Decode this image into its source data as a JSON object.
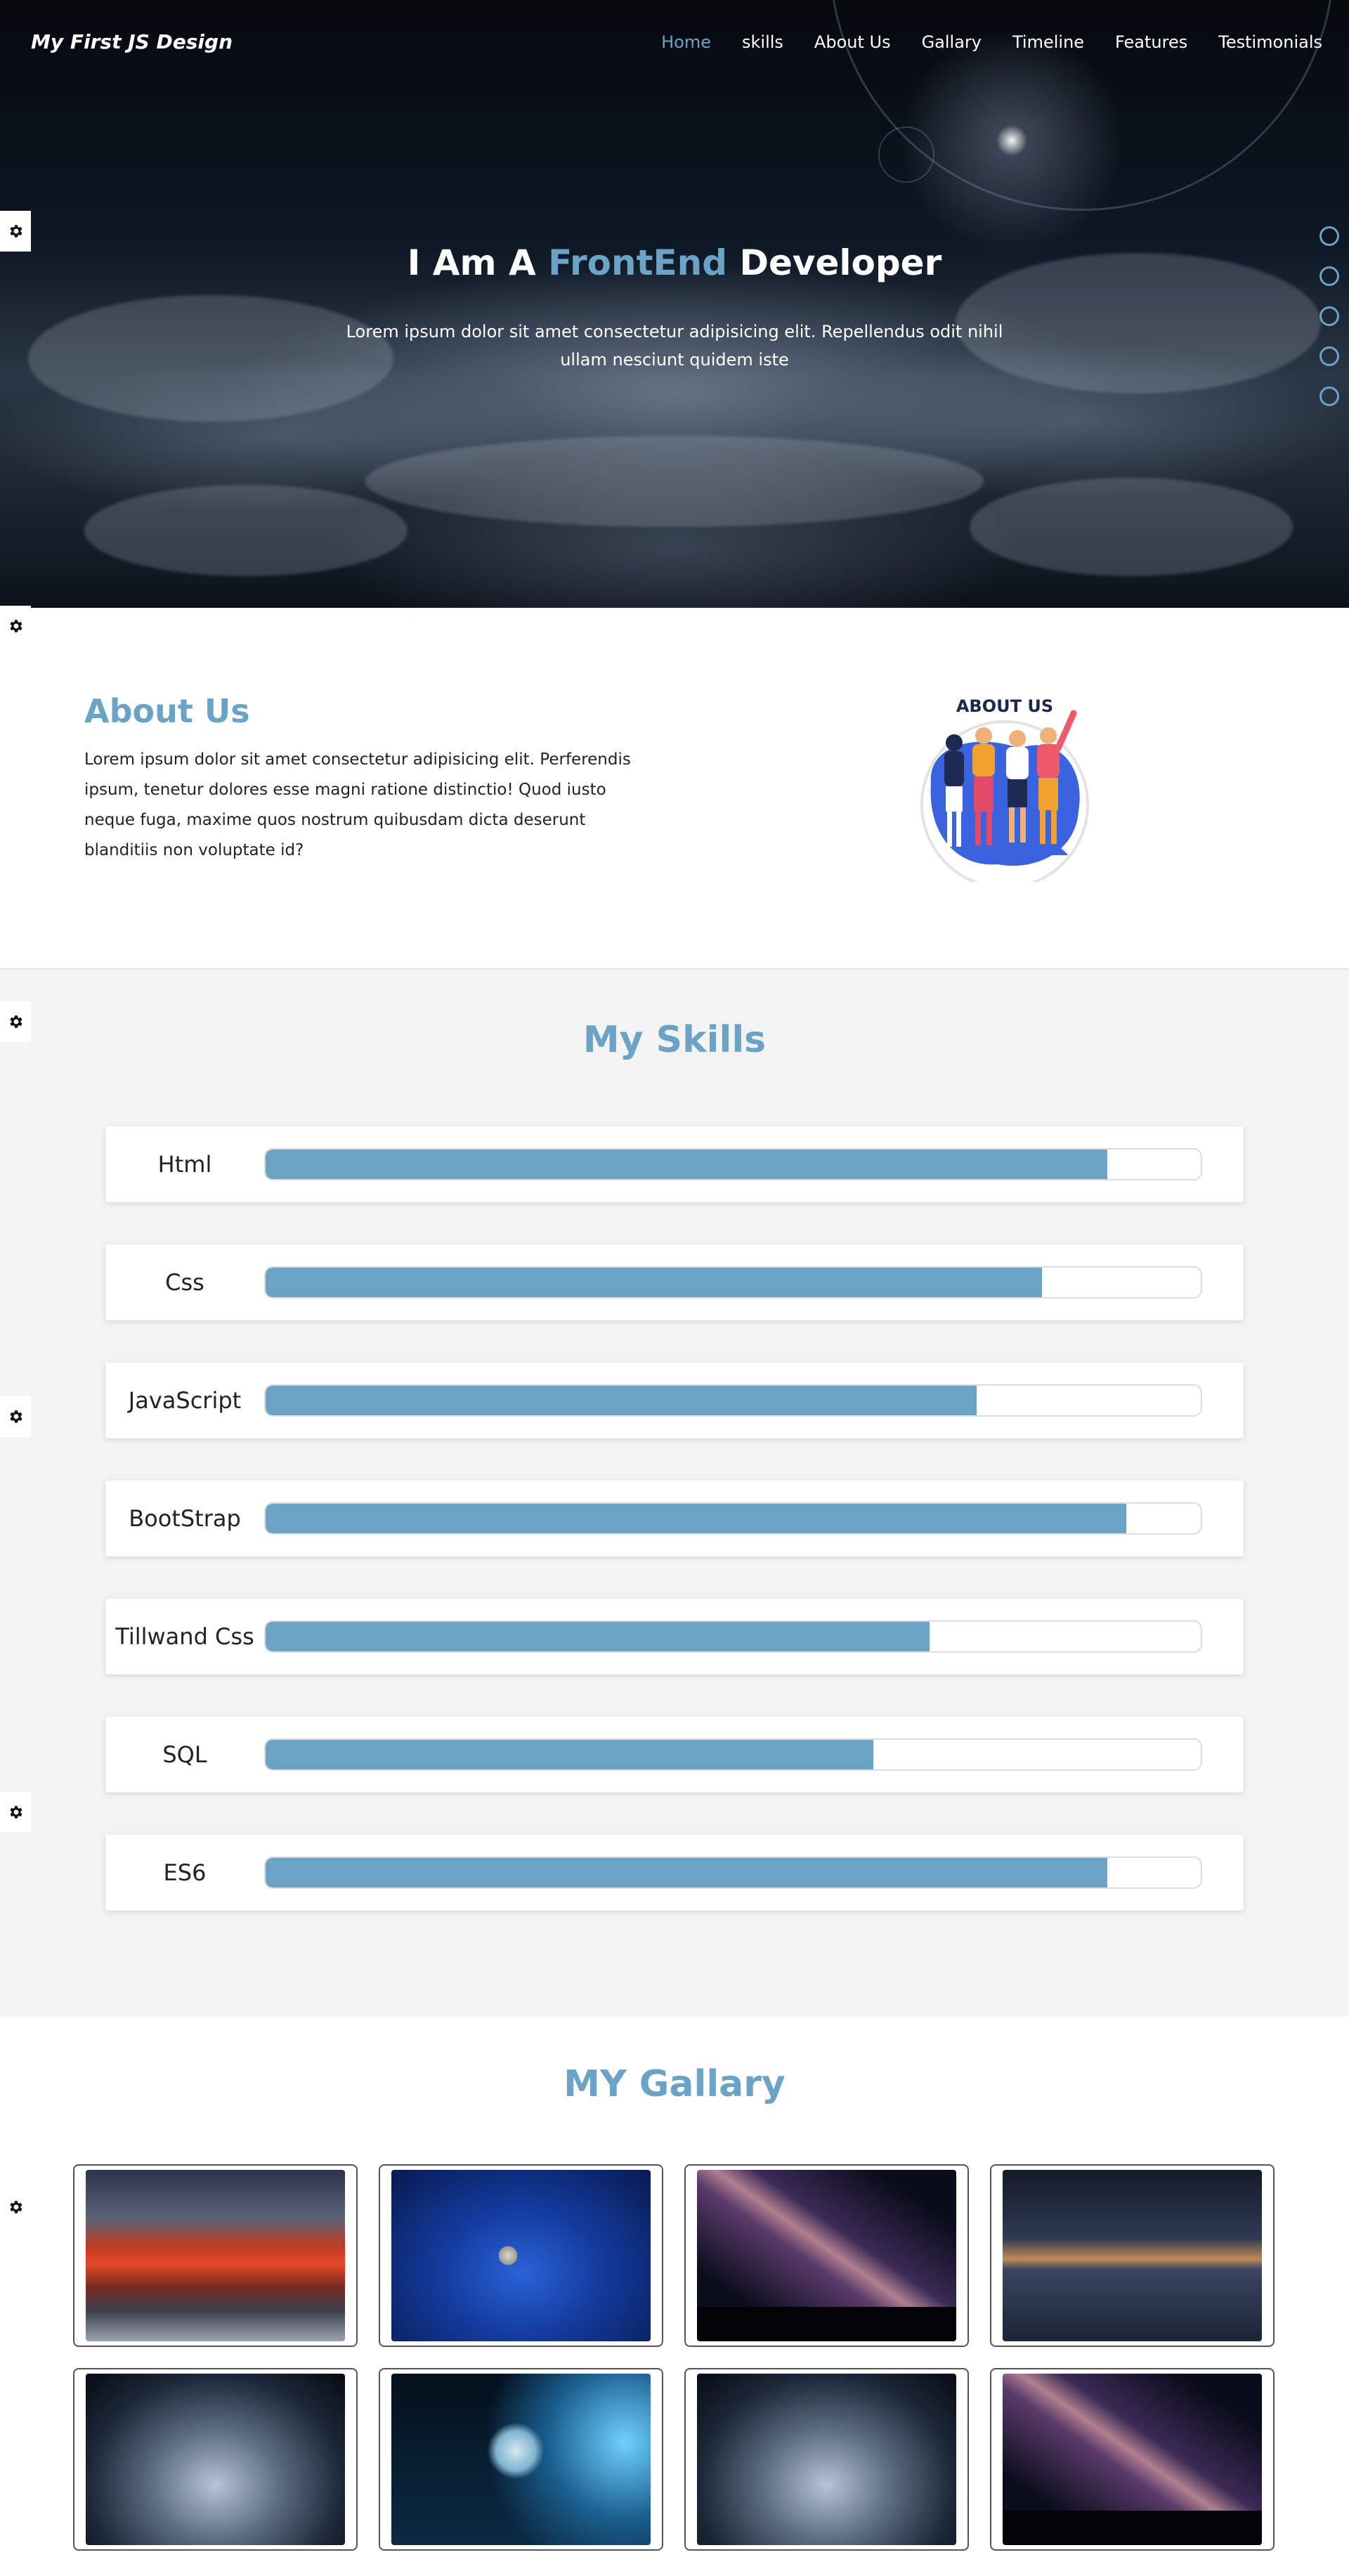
{
  "nav": {
    "logo": "My First JS Design",
    "links": [
      "Home",
      "skills",
      "About Us",
      "Gallary",
      "Timeline",
      "Features",
      "Testimonials"
    ]
  },
  "hero": {
    "title_pre": "I Am A ",
    "title_highlight": "FrontEnd",
    "title_post": " Developer",
    "subtitle": "Lorem ipsum dolor sit amet consectetur adipisicing elit. Repellendus odit nihil ullam nesciunt quidem iste",
    "bullet_count": 5
  },
  "about": {
    "title": "About Us",
    "text": "Lorem ipsum dolor sit amet consectetur adipisicing elit. Perferendis ipsum, tenetur dolores esse magni ratione distinctio! Quod iusto neque fuga, maxime quos nostrum quibusdam dicta deserunt blanditiis non voluptate id?",
    "image_label": "ABOUT US"
  },
  "skills": {
    "title": "My Skills",
    "items": [
      {
        "name": "Html",
        "percent": 90
      },
      {
        "name": "Css",
        "percent": 83
      },
      {
        "name": "JavaScript",
        "percent": 76
      },
      {
        "name": "BootStrap",
        "percent": 92
      },
      {
        "name": "Tillwand Css",
        "percent": 71
      },
      {
        "name": "SQL",
        "percent": 65
      },
      {
        "name": "ES6",
        "percent": 90
      }
    ]
  },
  "gallery": {
    "title": "MY Gallary",
    "images": [
      "red-mountain-photo",
      "moon-in-blue-space-photo",
      "milky-way-photo",
      "sunset-boat-reflection-photo",
      "cloudy-planet-vortex-photo",
      "astronaut-photo",
      "cloudy-planet-vortex-photo",
      "milky-way-photo"
    ]
  },
  "colors": {
    "accent": "#6aa3c6",
    "hero_text": "#ffffff",
    "skills_bg": "#f3f3f3"
  },
  "icons": {
    "settings": "gear-icon",
    "bullets": "circle-bullet-icon"
  }
}
